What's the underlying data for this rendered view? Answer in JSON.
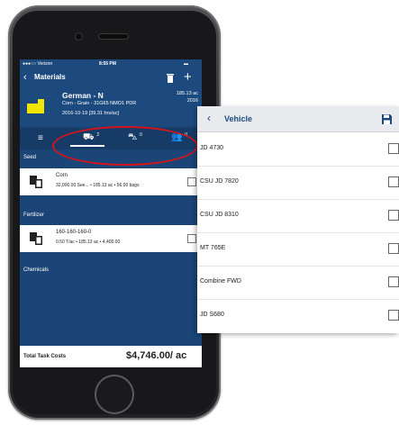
{
  "status": {
    "carrier": "Verizon",
    "time": "8:55 PM",
    "battery": "▮"
  },
  "nav": {
    "back": "‹",
    "title": "Materials",
    "add": "+"
  },
  "field": {
    "name": "German - N",
    "crop": "Corn - Grain - 31G65 NMO1 PDR",
    "date": "2016-10-19 [39.31 hrs/ac]",
    "area": "185.13 ac",
    "year": "2016"
  },
  "tabs": {
    "menu": "≡",
    "vehicles_count": "2",
    "tractors_count": "0",
    "people_count": "0"
  },
  "sections": {
    "seed": "Seed",
    "fertilizer": "Fertilizer",
    "chemicals": "Chemicals"
  },
  "seed_row": {
    "name": "Corn",
    "detail": "32,000.00 See... • 185.13 ac • 56.00 bags"
  },
  "fertilizer_row": {
    "name": "160-160-160-0",
    "detail": "0.50 T/ac • 185.13 ac • 4,400.00"
  },
  "footer": {
    "label": "Total Task Costs",
    "total": "$4,746.00/ ac"
  },
  "panel": {
    "back": "‹",
    "title": "Vehicle",
    "vehicles": [
      {
        "name": "JD 4730",
        "checked": false
      },
      {
        "name": "CSU JD 7820",
        "checked": false
      },
      {
        "name": "CSU JD 8310",
        "checked": false
      },
      {
        "name": "MT 765E",
        "checked": false
      },
      {
        "name": "Combine FWD",
        "checked": false
      },
      {
        "name": "JD S680",
        "checked": false
      }
    ]
  },
  "colors": {
    "app_blue": "#1d4a7e",
    "callout_red": "#d4141c",
    "field_yellow": "#f2e600"
  }
}
